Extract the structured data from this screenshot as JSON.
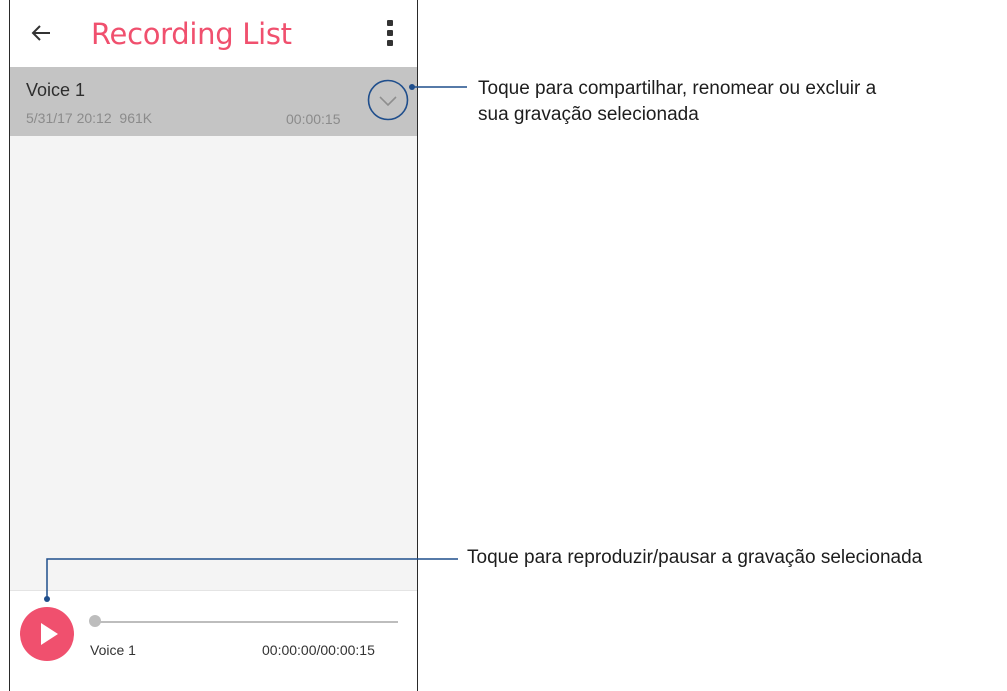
{
  "app_bar": {
    "title": "Recording List",
    "back_icon": "arrow-left-icon",
    "more_icon": "more-vert-icon",
    "title_color": "#f0506e"
  },
  "recordings": [
    {
      "name": "Voice 1",
      "datetime": "5/31/17 20:12",
      "size": "961K",
      "duration": "00:00:15",
      "selected": true,
      "expand_icon": "chevron-down-icon"
    }
  ],
  "player": {
    "play_icon": "play-icon",
    "track_name": "Voice 1",
    "time": "00:00:00/00:00:15",
    "progress": 0,
    "accent": "#f0506e"
  },
  "callouts": {
    "expand": {
      "line1": "Toque para compartilhar, renomear ou excluir a",
      "line2": "sua gravação selecionada"
    },
    "play": {
      "text": "Toque para reproduzir/pausar a gravação selecionada"
    },
    "line_color": "#1f4e8c"
  }
}
